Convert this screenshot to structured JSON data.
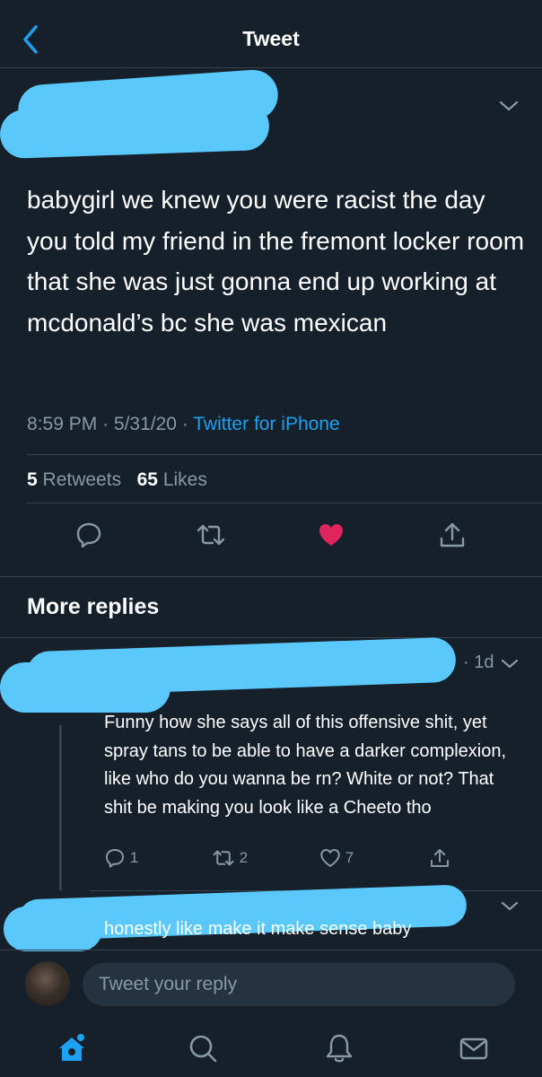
{
  "header": {
    "title": "Tweet"
  },
  "tweet": {
    "text": "babygirl we knew you were racist the day you told my friend in the fremont locker room that she was just gonna end up working at mcdonald’s bc she was mexican",
    "time": "8:59 PM",
    "date": "5/31/20",
    "source": "Twitter for iPhone",
    "retweets_count": "5",
    "retweets_label": "Retweets",
    "likes_count": "65",
    "likes_label": "Likes",
    "liked": true
  },
  "more_replies": {
    "title": "More replies"
  },
  "reply1": {
    "time": "1d",
    "text": "Funny how she says all of this offensive shit, yet spray tans to be able to have a darker complexion, like who do you wanna be rn? White or not? That shit be making you look like a Cheeto tho",
    "replies_count": "1",
    "retweets_count": "2",
    "likes_count": "7"
  },
  "reply2": {
    "text": "honestly like make it make sense baby"
  },
  "composer": {
    "placeholder": "Tweet your reply"
  },
  "icons": {
    "back": "chevron-left-icon",
    "caret": "chevron-down-icon",
    "reply": "reply-icon",
    "retweet": "retweet-icon",
    "like": "heart-icon",
    "share": "share-icon",
    "home": "home-icon",
    "search": "search-icon",
    "notifications": "bell-icon",
    "messages": "mail-icon"
  },
  "colors": {
    "background": "#15202b",
    "accent": "#1da1f2",
    "like": "#e0245e",
    "secondary_text": "#8899a6",
    "redaction": "#5ac8fa"
  }
}
